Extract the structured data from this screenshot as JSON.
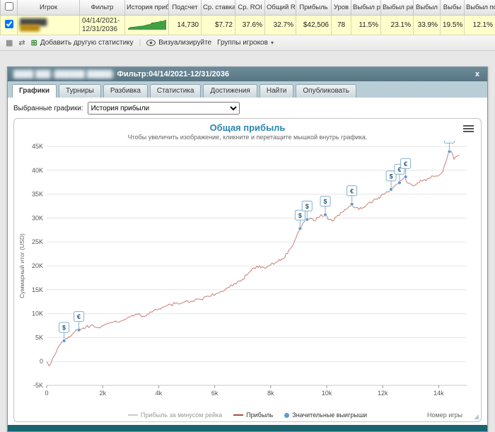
{
  "table": {
    "headers": [
      "Игрок",
      "Фильтр",
      "История прибы",
      "Подсчет",
      "Ср. ставка",
      "Ср. ROI",
      "Общий ROI",
      "Прибыль",
      "Уров",
      "Выбыл ран",
      "Выбыл рано/",
      "Выбыл",
      "Выбы",
      "Выбыл поз"
    ],
    "row": {
      "player_redacted": "██████",
      "player_redacted2": "█████",
      "filter_line1": "04/14/2021-",
      "filter_line2": "12/31/2036",
      "count": "14,730",
      "avg_stake": "$7.72",
      "avg_roi": "37.6%",
      "total_roi": "32.7%",
      "profit": "$42,506",
      "level": "78",
      "out_early": "11.5%",
      "out_early_mid": "23.1%",
      "out_mid": "33.9%",
      "out_late_mid": "19.5%",
      "out_late": "12.1%"
    }
  },
  "toolbar": {
    "add_stat": "Добавить другую статистику",
    "visualize": "Визуализируйте",
    "groups": "Группы игроков",
    "groups_caret": "▾",
    "report_icon": "▦",
    "refresh_icon": "⇄",
    "plus_icon": "⊞"
  },
  "panel": {
    "title_redacted": "████ ███ (██████ █████)",
    "filter_title": "Фильтр:04/14/2021-12/31/2036",
    "close": "x",
    "tabs": [
      "Графики",
      "Турниры",
      "Разбивка",
      "Статистика",
      "Достижения",
      "Найти",
      "Опубликовать"
    ],
    "select_label": "Выбранные графики:",
    "select_value": "История прибыли"
  },
  "chart_data": {
    "type": "line",
    "title": "Общая прибыль",
    "subtitle": "Чтобы увеличить изображение, кликните и перетащите мышкой внутрь графика.",
    "xlabel": "Номер игры",
    "ylabel": "Суммарный итог (USD)",
    "xlim": [
      0,
      15000
    ],
    "ylim": [
      -5000,
      45000
    ],
    "grid": true,
    "xticks": [
      {
        "v": 0,
        "label": "0"
      },
      {
        "v": 2000,
        "label": "2k"
      },
      {
        "v": 4000,
        "label": "4k"
      },
      {
        "v": 6000,
        "label": "6k"
      },
      {
        "v": 8000,
        "label": "8k"
      },
      {
        "v": 10000,
        "label": "10k"
      },
      {
        "v": 12000,
        "label": "12k"
      },
      {
        "v": 14000,
        "label": "14k"
      }
    ],
    "yticks": [
      {
        "v": 45000,
        "label": "45K"
      },
      {
        "v": 40000,
        "label": "40K"
      },
      {
        "v": 35000,
        "label": "35K"
      },
      {
        "v": 30000,
        "label": "30K"
      },
      {
        "v": 25000,
        "label": "25K"
      },
      {
        "v": 20000,
        "label": "20K"
      },
      {
        "v": 15000,
        "label": "15K"
      },
      {
        "v": 10000,
        "label": "10K"
      },
      {
        "v": 5000,
        "label": "5K"
      },
      {
        "v": 0,
        "label": "0"
      },
      {
        "v": -5000,
        "label": "-5K"
      }
    ],
    "legend": [
      {
        "label": "Прибыль за минусом рейка",
        "color": "#c9c9c9",
        "type": "line",
        "muted": true
      },
      {
        "label": "Прибыль",
        "color": "#9c4f45",
        "type": "line",
        "muted": false
      },
      {
        "label": "Значительные выигрыши",
        "color": "#5b9bd5",
        "type": "dot",
        "muted": false
      }
    ],
    "series": {
      "name": "Прибыль",
      "color": "#c97f78",
      "points": [
        [
          0,
          0
        ],
        [
          80,
          -900
        ],
        [
          200,
          400
        ],
        [
          350,
          2100
        ],
        [
          500,
          3700
        ],
        [
          620,
          4300
        ],
        [
          800,
          5200
        ],
        [
          1000,
          6200
        ],
        [
          1150,
          6600
        ],
        [
          1400,
          7200
        ],
        [
          1650,
          7600
        ],
        [
          1900,
          7000
        ],
        [
          2100,
          7800
        ],
        [
          2400,
          8300
        ],
        [
          2700,
          8600
        ],
        [
          3000,
          9400
        ],
        [
          3200,
          9900
        ],
        [
          3450,
          9500
        ],
        [
          3700,
          10400
        ],
        [
          4000,
          11000
        ],
        [
          4300,
          11700
        ],
        [
          4600,
          12100
        ],
        [
          4900,
          12400
        ],
        [
          5200,
          12600
        ],
        [
          5500,
          13000
        ],
        [
          5800,
          13600
        ],
        [
          6100,
          14300
        ],
        [
          6400,
          15200
        ],
        [
          6700,
          16300
        ],
        [
          7000,
          17200
        ],
        [
          7200,
          18400
        ],
        [
          7400,
          19600
        ],
        [
          7600,
          20000
        ],
        [
          7800,
          19500
        ],
        [
          8000,
          20200
        ],
        [
          8200,
          20800
        ],
        [
          8400,
          21400
        ],
        [
          8600,
          22600
        ],
        [
          8800,
          24400
        ],
        [
          9000,
          27200
        ],
        [
          9100,
          28300
        ],
        [
          9250,
          29500
        ],
        [
          9400,
          29900
        ],
        [
          9550,
          29400
        ],
        [
          9750,
          30300
        ],
        [
          9950,
          30700
        ],
        [
          10050,
          29700
        ],
        [
          10200,
          29400
        ],
        [
          10350,
          30300
        ],
        [
          10550,
          31200
        ],
        [
          10750,
          32100
        ],
        [
          10900,
          32900
        ],
        [
          11050,
          32200
        ],
        [
          11250,
          32000
        ],
        [
          11450,
          32900
        ],
        [
          11650,
          33500
        ],
        [
          11850,
          34300
        ],
        [
          12050,
          35000
        ],
        [
          12250,
          35700
        ],
        [
          12400,
          36500
        ],
        [
          12600,
          37400
        ],
        [
          12800,
          38500
        ],
        [
          12900,
          37300
        ],
        [
          13050,
          36900
        ],
        [
          13250,
          37400
        ],
        [
          13450,
          37900
        ],
        [
          13650,
          38300
        ],
        [
          13850,
          38700
        ],
        [
          14050,
          39100
        ],
        [
          14150,
          39700
        ],
        [
          14250,
          41600
        ],
        [
          14350,
          43700
        ],
        [
          14450,
          44000
        ],
        [
          14550,
          42300
        ],
        [
          14650,
          42900
        ],
        [
          14730,
          43200
        ]
      ]
    },
    "flags": [
      {
        "x": 620,
        "y": 4300,
        "s": "$"
      },
      {
        "x": 1150,
        "y": 6600,
        "s": "€"
      },
      {
        "x": 9050,
        "y": 27800,
        "s": "$"
      },
      {
        "x": 9300,
        "y": 29700,
        "s": "$"
      },
      {
        "x": 9950,
        "y": 30700,
        "s": "$"
      },
      {
        "x": 10900,
        "y": 32900,
        "s": "€"
      },
      {
        "x": 12300,
        "y": 36000,
        "s": "$"
      },
      {
        "x": 12600,
        "y": 37400,
        "s": "€"
      },
      {
        "x": 12820,
        "y": 38600,
        "s": "€"
      },
      {
        "x": 14380,
        "y": 43900,
        "s": "$"
      }
    ]
  }
}
